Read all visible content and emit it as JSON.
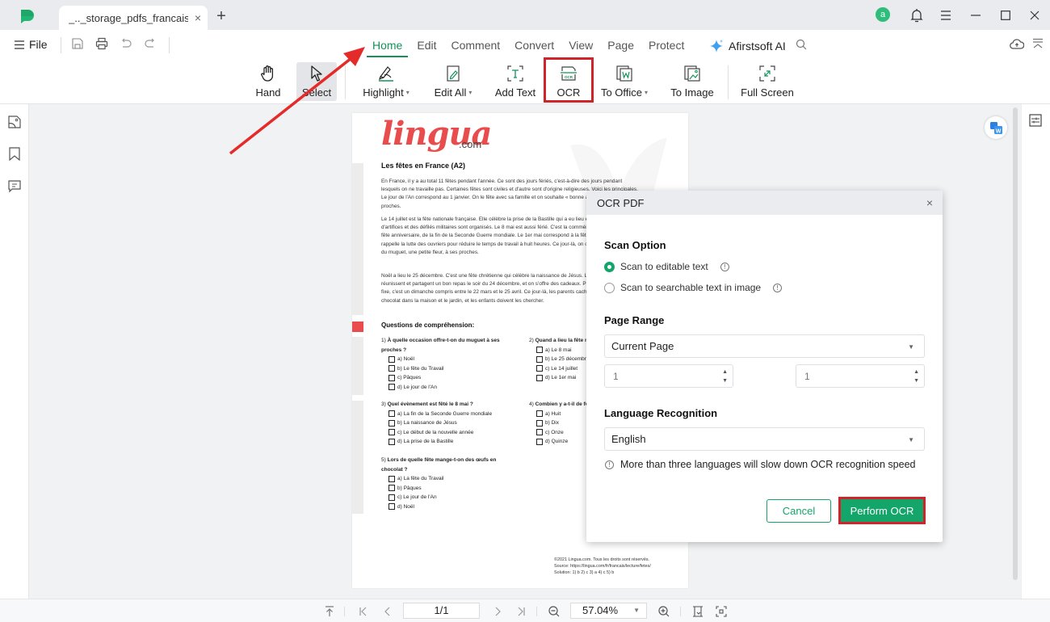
{
  "titlebar": {
    "tab_title": "_.._storage_pdfs_francais...",
    "tab_close": "×",
    "new_tab": "+",
    "avatar_letter": "a",
    "icons": [
      "app-logo-icon",
      "bell-icon",
      "hamburger-menu-icon",
      "minimize-icon",
      "maximize-icon",
      "close-icon"
    ]
  },
  "ribbon": {
    "file_label": "File",
    "quick_tools": [
      "save-icon",
      "print-icon",
      "undo-icon",
      "redo-icon"
    ],
    "menu_tabs": [
      "Home",
      "Edit",
      "Comment",
      "Convert",
      "View",
      "Page",
      "Protect"
    ],
    "active_tab": "Home",
    "ai_label": "Afirstsoft AI",
    "tools": {
      "hand": "Hand",
      "select": "Select",
      "highlight": "Highlight",
      "edit_all": "Edit All",
      "add_text": "Add Text",
      "ocr": "OCR",
      "to_office": "To Office",
      "to_image": "To Image",
      "full_screen": "Full Screen"
    },
    "caret": "▾",
    "accent_color": "#12935a"
  },
  "document": {
    "logo": "lingua",
    "logo_suffix": ".com",
    "title": "Les fêtes en France (A2)",
    "paragraphs": [
      "En France, il y a au total 11 fêtes pendant l'année. Ce sont des jours fériés, c'est-à-dire des jours pendant lesquels on ne travaille pas. Certaines fêtes sont civiles et d'autre sont d'origine religieuses. Voici les principales. Le jour de l'An correspond au 1 janvier. On le fête avec sa famille et on souhaite « bonne année ! » à ses proches.",
      "Le 14 juillet est la fête nationale française. Elle célèbre la prise de la Bastille qui a eu lieu en 1789. Des feux d'artifices et des défilés militaires sont organisés. Le 8 mai est aussi férié. C'est la commémoration, c'est-à-dire la fête anniversaire, de la fin de la Seconde Guerre mondiale. Le 1er mai correspond à la fête du Travail, et rappelle la lutte des ouvriers pour réduire le temps de travail à huit heures. Ce jour-là, on offre traditionnellement du muguet, une petite fleur, à ses proches.",
      "Noël a lieu le 25 décembre. C'est une fête chrétienne qui célèbre la naissance de Jésus. Les familles se réunissent et partagent un bon repas le soir du 24 décembre, et on s'offre des cadeaux. Pâques n'a pas de date fixe, c'est un dimanche compris entre le 22 mars et le 25 avril. Ce jour-là, les parents cachent des oeufs en chocolat dans la maison et le jardin, et les enfants doivent les chercher."
    ],
    "questions_title": "Questions de compréhension:",
    "questions": [
      {
        "num": "1)",
        "text": "À quelle occasion offre-t-on du muguet à ses proches ?",
        "options": [
          "a) Noël",
          "b) Le fête du Travail",
          "c) Pâques",
          "d) Le jour de l'An"
        ]
      },
      {
        "num": "2)",
        "text": "Quand a lieu la fête nationale ?",
        "options": [
          "a) Le 8 mai",
          "b) Le 25 décembre",
          "c) Le 14 juillet",
          "d) Le 1er mai"
        ]
      },
      {
        "num": "3)",
        "text": "Quel évènement est fêté le 8 mai ?",
        "options": [
          "a) La fin de la Seconde Guerre mondiale",
          "b) La naissance de Jésus",
          "c) Le début de la nouvelle année",
          "d) La prise de la Bastille"
        ]
      },
      {
        "num": "4)",
        "text": "Combien y a-t-il de fêtes ?",
        "options": [
          "a) Huit",
          "b) Dix",
          "c) Onze",
          "d) Quinze"
        ]
      },
      {
        "num": "5)",
        "text": "Lors de quelle fête mange-t-on des œufs en chocolat ?",
        "options": [
          "a) La fête du Travail",
          "b) Pâques",
          "c) Le jour de l'An",
          "d) Noël"
        ]
      }
    ],
    "footer": [
      "©2021 Lingua.com. Tous les droits sont réservés.",
      "Source: https://lingua.com/fr/francais/lecture/fetes/",
      "Solution: 1) b 2) c 3) a 4) c 5) b"
    ]
  },
  "dialog": {
    "title": "OCR PDF",
    "close": "×",
    "scan_option_label": "Scan Option",
    "scan_options": [
      {
        "label": "Scan to editable text",
        "checked": true
      },
      {
        "label": "Scan to searchable text in image",
        "checked": false
      }
    ],
    "page_range_label": "Page Range",
    "page_range_value": "Current Page",
    "page_from": "1",
    "page_to": "1",
    "language_label": "Language Recognition",
    "language_value": "English",
    "note": "More than three languages will slow down OCR recognition speed",
    "cancel_label": "Cancel",
    "perform_label": "Perform OCR",
    "primary_color": "#14a56a",
    "highlight_color": "#d1232a"
  },
  "bottombar": {
    "page_value": "1/1",
    "zoom_value": "57.04%"
  },
  "sidebar": {
    "left_icons": [
      "thumbnail-icon",
      "bookmark-icon",
      "comment-icon"
    ],
    "right_icons": [
      "properties-icon"
    ]
  }
}
